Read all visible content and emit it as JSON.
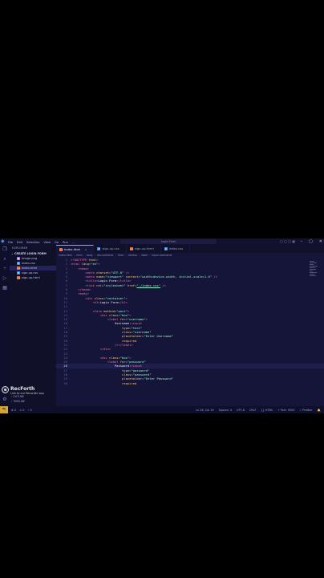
{
  "window": {
    "search_text": "Login Form",
    "layout_icons": "▢ ▢ ▢ ▦",
    "controls": {
      "minimize": "–",
      "maximize": "▢",
      "close": "✕"
    }
  },
  "menu": [
    "File",
    "Edit",
    "Selection",
    "View",
    "Go",
    "Run",
    "…"
  ],
  "activity": [
    {
      "name": "files-icon",
      "glyph": "❐"
    },
    {
      "name": "search-icon",
      "glyph": "⌕"
    },
    {
      "name": "source-control-icon",
      "glyph": "⑂"
    },
    {
      "name": "run-debug-icon",
      "glyph": "▷"
    },
    {
      "name": "extensions-icon",
      "glyph": "▦"
    }
  ],
  "activity_bottom": [
    {
      "name": "account-icon",
      "glyph": "◯"
    },
    {
      "name": "settings-gear-icon",
      "glyph": "⚙"
    }
  ],
  "sidebar": {
    "title": "EXPLORER",
    "folder": "CREATE LOGIN FORM",
    "files": [
      {
        "name": "image.png",
        "icon": "▣",
        "color": "#a66bd6"
      },
      {
        "name": "index.css",
        "icon": "#",
        "color": "#3b8eea"
      },
      {
        "name": "index.html",
        "icon": "<>",
        "color": "#e36a3d"
      },
      {
        "name": "sign-up.css",
        "icon": "#",
        "color": "#3b8eea"
      },
      {
        "name": "sign-up.html",
        "icon": "<>",
        "color": "#e36a3d"
      }
    ],
    "outline": "OUTLINE",
    "timeline": "TIMELINE"
  },
  "tabs": [
    {
      "label": "index.html",
      "icon": "<>",
      "color": "#e36a3d",
      "active": true
    },
    {
      "label": "sign-up.css",
      "icon": "#",
      "color": "#3b8eea",
      "active": false
    },
    {
      "label": "sign-up.html",
      "icon": "<>",
      "color": "#e36a3d",
      "active": false
    },
    {
      "label": "index.css",
      "icon": "#",
      "color": "#3b8eea",
      "active": false
    }
  ],
  "breadcrumb": [
    "index.html",
    "html",
    "body",
    "div.container",
    "form",
    "div.box",
    "label",
    "input.username"
  ],
  "code_lines": [
    {
      "n": "1",
      "h": "<span class='tg'>&lt;!DOCTYPE</span> <span class='at'>html</span><span class='tg'>&gt;</span>"
    },
    {
      "n": "2",
      "h": "<span class='tg'>&lt;html</span> <span class='at'>lang</span>=<span class='st'>\"en\"</span><span class='tg'>&gt;</span>"
    },
    {
      "n": "3",
      "h": "    <span class='tg'>&lt;head&gt;</span>"
    },
    {
      "n": "4",
      "h": "        <span class='tg'>&lt;meta</span> <span class='at'>charset</span>=<span class='st'>\"UTF-8\"</span> <span class='tg'>/&gt;</span>"
    },
    {
      "n": "5",
      "h": "        <span class='tg'>&lt;meta</span> <span class='at'>name</span>=<span class='st'>\"viewport\"</span> <span class='at'>content</span>=<span class='st'>\"width=device-width, initial-scale=1.0\"</span> <span class='tg'>/&gt;</span>"
    },
    {
      "n": "6",
      "h": "        <span class='tg'>&lt;title&gt;</span><span class='tx2'>Login Form</span><span class='tg'>&lt;/title&gt;</span>"
    },
    {
      "n": "7",
      "h": "        <span class='tg'>&lt;link</span> <span class='at'>rel</span>=<span class='st'>\"stylesheet\"</span> <span class='at'>href</span>=<span class='st ul'>\"./index.css\"</span> <span class='tg'>/&gt;</span>"
    },
    {
      "n": "8",
      "h": "    <span class='tg'>&lt;/head&gt;</span>"
    },
    {
      "n": "9",
      "h": "    <span class='tg'>&lt;body&gt;</span>"
    },
    {
      "n": "10",
      "h": "        <span class='tg'>&lt;div</span> <span class='at'>class</span>=<span class='st'>\"container\"</span><span class='tg'>&gt;</span>"
    },
    {
      "n": "11",
      "h": "            <span class='tg'>&lt;h1&gt;</span><span class='tx2'>Login Form</span><span class='tg'>&lt;/h1&gt;</span>"
    },
    {
      "n": "12",
      "h": ""
    },
    {
      "n": "13",
      "h": "            <span class='tg'>&lt;form</span> <span class='at'>method</span>=<span class='st'>\"post\"</span><span class='tg'>&gt;</span>"
    },
    {
      "n": "14",
      "h": "                <span class='tg'>&lt;div</span> <span class='at'>class</span>=<span class='st'>\"box\"</span><span class='tg'>&gt;</span>"
    },
    {
      "n": "15",
      "h": "                    <span class='tg'>&lt;label</span> <span class='at'>for</span>=<span class='st'>\"username\"</span><span class='tg'>&gt;</span>"
    },
    {
      "n": "16",
      "h": "                        <span class='tx2'>Username:</span><span class='tg'>&lt;input</span>"
    },
    {
      "n": "17",
      "h": "                            <span class='at'>type</span>=<span class='st'>\"text\"</span>"
    },
    {
      "n": "18",
      "h": "                            <span class='at'>class</span>=<span class='st'>\"username\"</span>"
    },
    {
      "n": "19",
      "h": "                            <span class='at'>placeholder</span>=<span class='st'>\"Enter Username\"</span>"
    },
    {
      "n": "20",
      "h": "                            <span class='at'>required</span>"
    },
    {
      "n": "21",
      "h": "                        <span class='tg'>/&gt;&lt;/label&gt;</span>"
    },
    {
      "n": "22",
      "h": "                <span class='tg'>&lt;/div&gt;</span>"
    },
    {
      "n": "23",
      "h": ""
    },
    {
      "n": "24",
      "h": "                <span class='tg'>&lt;div</span> <span class='at'>class</span>=<span class='st'>\"box\"</span><span class='tg'>&gt;</span>"
    },
    {
      "n": "25",
      "h": "                    <span class='tg'>&lt;label</span> <span class='at'>for</span>=<span class='st'>\"password\"</span>"
    },
    {
      "n": "26",
      "h": "                        <span class='tx2'>Password:</span><span class='tg'>&lt;input</span>",
      "cur": true
    },
    {
      "n": "27",
      "h": "                            <span class='at'>type</span>=<span class='st'>\"password\"</span>"
    },
    {
      "n": "28",
      "h": "                            <span class='at'>class</span>=<span class='st'>\"password\"</span>"
    },
    {
      "n": "29",
      "h": "                            <span class='at'>placeholder</span>=<span class='st'>\"Enter Password\"</span>"
    },
    {
      "n": "30",
      "h": "                            <span class='at'>required</span>"
    }
  ],
  "watermark": {
    "name": "RecForth",
    "sub": "Link to our Recorder app"
  },
  "status": {
    "left": [
      "⊗ 0",
      "⚠ 0",
      "⑂ 0"
    ],
    "right": [
      "Ln 26, Col 19",
      "Spaces: 4",
      "UTF-8",
      "CRLF",
      "{} HTML",
      "⚡ Port: 5500",
      "✓ Prettier",
      "🔔"
    ]
  }
}
